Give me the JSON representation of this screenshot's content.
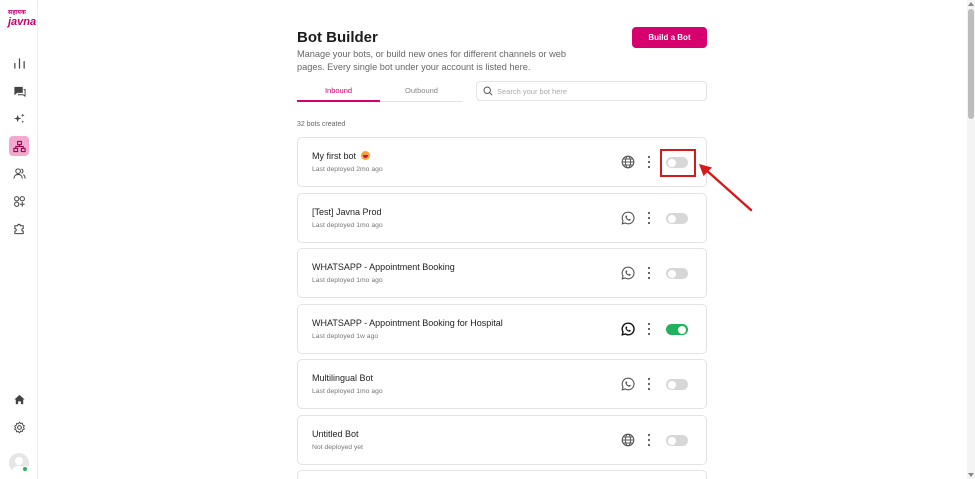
{
  "logo": {
    "line1": "सहायक",
    "line2": "javna"
  },
  "sidebar": {
    "items": [
      {
        "name": "analytics"
      },
      {
        "name": "conversations"
      },
      {
        "name": "ai-features"
      },
      {
        "name": "bot-builder",
        "active": true
      },
      {
        "name": "users"
      },
      {
        "name": "integrations"
      },
      {
        "name": "plugins"
      }
    ],
    "bottom": [
      {
        "name": "home"
      },
      {
        "name": "settings"
      }
    ]
  },
  "header": {
    "title": "Bot Builder",
    "subtitle": "Manage your bots, or build new ones for different channels or web pages. Every single bot under your account is listed here.",
    "build_button": "Build a Bot"
  },
  "tabs": [
    {
      "label": "Inbound",
      "active": true
    },
    {
      "label": "Outbound",
      "active": false
    }
  ],
  "search": {
    "placeholder": "Search your bot here",
    "value": ""
  },
  "bots_count": "32 bots created",
  "bots": [
    {
      "name": "My first bot",
      "emoji": "grinning-face-emoji",
      "meta": "Last deployed 2mo ago",
      "channel": "web-globe-icon",
      "enabled": false
    },
    {
      "name": "[Test] Javna Prod",
      "meta": "Last deployed 1mo ago",
      "channel": "whatsapp-icon",
      "enabled": false
    },
    {
      "name": "WHATSAPP - Appointment Booking",
      "meta": "Last deployed 1mo ago",
      "channel": "whatsapp-icon",
      "enabled": false
    },
    {
      "name": "WHATSAPP - Appointment Booking for Hospital",
      "meta": "Last deployed 1w ago",
      "channel": "whatsapp-icon",
      "enabled": true
    },
    {
      "name": "Multilingual Bot",
      "meta": "Last deployed 1mo ago",
      "channel": "whatsapp-icon",
      "enabled": false
    },
    {
      "name": "Untitled Bot",
      "meta": "Not deployed yet",
      "channel": "web-globe-icon",
      "enabled": false
    }
  ],
  "colors": {
    "brand": "#d6006f",
    "toggle_on": "#1fb15b",
    "toggle_off": "#d7d7d7",
    "annotation": "#d41a1a"
  }
}
